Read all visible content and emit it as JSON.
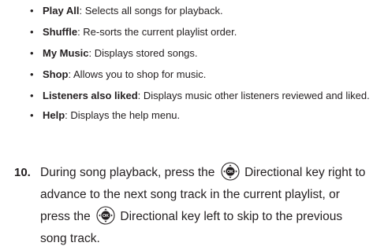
{
  "bullets": [
    {
      "term": "Play All",
      "desc": ": Selects all songs for playback."
    },
    {
      "term": "Shuffle",
      "desc": ": Re-sorts the current playlist order."
    },
    {
      "term": "My Music",
      "desc": ": Displays stored songs."
    },
    {
      "term": "Shop",
      "desc": ": Allows you to shop for music."
    },
    {
      "term": "Listeners also liked",
      "desc": ": Displays music other listeners reviewed and liked."
    },
    {
      "term": "Help",
      "desc": ": Displays the help menu."
    }
  ],
  "step": {
    "number": "10.",
    "part1": "During song playback, press the",
    "part2": "Directional key right to advance to the next song track in the current playlist, or press the",
    "part3": "Directional key left to skip to the previous song track.",
    "key_icon": "ok-directional-key-icon",
    "key_label": "OK"
  }
}
